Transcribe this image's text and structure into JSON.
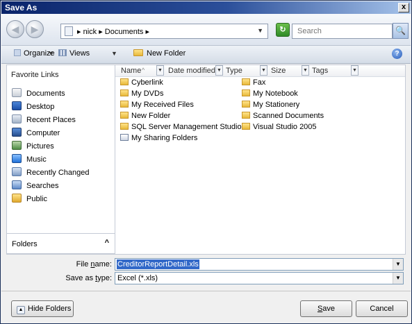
{
  "window": {
    "title": "Save As",
    "close_glyph": "x"
  },
  "address": {
    "back_glyph": "◀",
    "forward_glyph": "▶",
    "path": "▸ nick ▸ Documents ▸",
    "dropdown_glyph": "▼",
    "refresh_glyph": "↻",
    "search_placeholder": "Search",
    "search_glyph": "🔍"
  },
  "toolbar": {
    "organize": "Organize",
    "views": "Views",
    "new_folder": "New Folder",
    "dropdown_glyph": "▼",
    "help_glyph": "?"
  },
  "sidebar": {
    "header": "Favorite Links",
    "items": [
      {
        "label": "Documents",
        "icon": "documents-icon"
      },
      {
        "label": "Desktop",
        "icon": "desktop-icon"
      },
      {
        "label": "Recent Places",
        "icon": "recent-places-icon"
      },
      {
        "label": "Computer",
        "icon": "computer-icon"
      },
      {
        "label": "Pictures",
        "icon": "pictures-icon"
      },
      {
        "label": "Music",
        "icon": "music-icon"
      },
      {
        "label": "Recently Changed",
        "icon": "recently-changed-icon"
      },
      {
        "label": "Searches",
        "icon": "searches-icon"
      },
      {
        "label": "Public",
        "icon": "public-folder-icon"
      }
    ],
    "folders_label": "Folders",
    "folders_chevron": "^"
  },
  "columns": {
    "name": "Name",
    "date_modified": "Date modified",
    "type": "Type",
    "size": "Size",
    "tags": "Tags",
    "sort_glyph": "^",
    "filter_glyph": "▼"
  },
  "files": [
    {
      "name": "Cyberlink",
      "icon": "folder-icon"
    },
    {
      "name": "My DVDs",
      "icon": "folder-icon"
    },
    {
      "name": "My Received Files",
      "icon": "folder-icon"
    },
    {
      "name": "New Folder",
      "icon": "folder-icon"
    },
    {
      "name": "SQL Server Management Studio",
      "icon": "folder-icon"
    },
    {
      "name": "My Sharing Folders",
      "icon": "sharing-folder-icon"
    },
    {
      "name": "Fax",
      "icon": "folder-icon"
    },
    {
      "name": "My Notebook",
      "icon": "folder-icon"
    },
    {
      "name": "My Stationery",
      "icon": "folder-icon"
    },
    {
      "name": "Scanned Documents",
      "icon": "folder-icon"
    },
    {
      "name": "Visual Studio 2005",
      "icon": "folder-icon"
    }
  ],
  "form": {
    "file_name_label_pre": "File ",
    "file_name_label_ul": "n",
    "file_name_label_post": "ame:",
    "file_name_value": "CreditorReportDetail.xls",
    "save_type_label_pre": "Save as ",
    "save_type_label_ul": "t",
    "save_type_label_post": "ype:",
    "save_type_value": "Excel (*.xls)",
    "dropdown_glyph": "▼"
  },
  "buttons": {
    "hide_folders": "Hide Folders",
    "hide_glyph": "▲",
    "save_ul": "S",
    "save_rest": "ave",
    "cancel": "Cancel"
  }
}
